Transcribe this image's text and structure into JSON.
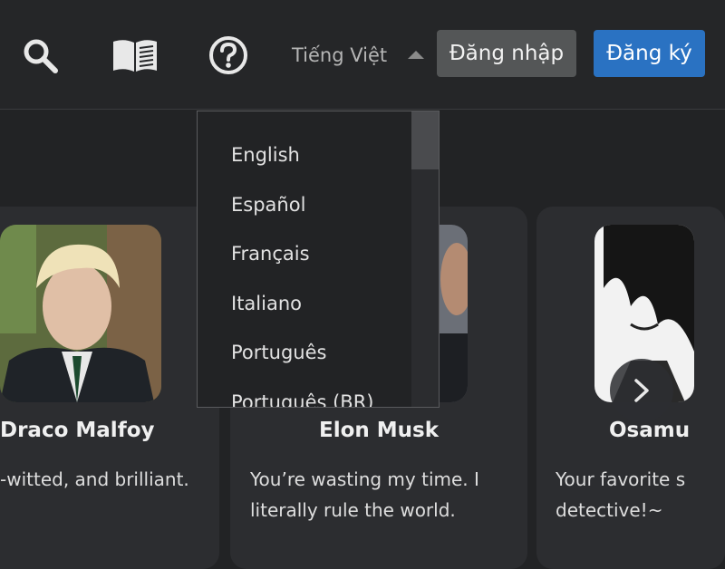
{
  "header": {
    "language_current": "Tiếng Việt",
    "login_label": "Đăng nhập",
    "signup_label": "Đăng ký",
    "icons": [
      "search-icon",
      "book-icon",
      "help-icon"
    ]
  },
  "language_menu": {
    "options": [
      "English",
      "Español",
      "Français",
      "Italiano",
      "Português",
      "Português (BR)"
    ]
  },
  "characters": [
    {
      "name": "Draco Malfoy",
      "desc": [
        "-witted, and brilliant."
      ]
    },
    {
      "name": "Elon Musk",
      "desc": [
        "You’re wasting my time. I",
        "literally rule the world."
      ]
    },
    {
      "name": "Osamu",
      "desc": [
        "Your favorite s",
        "detective!~"
      ]
    }
  ],
  "colors": {
    "accent": "#2a72c2",
    "background": "#222325",
    "card": "#2c2d30"
  }
}
